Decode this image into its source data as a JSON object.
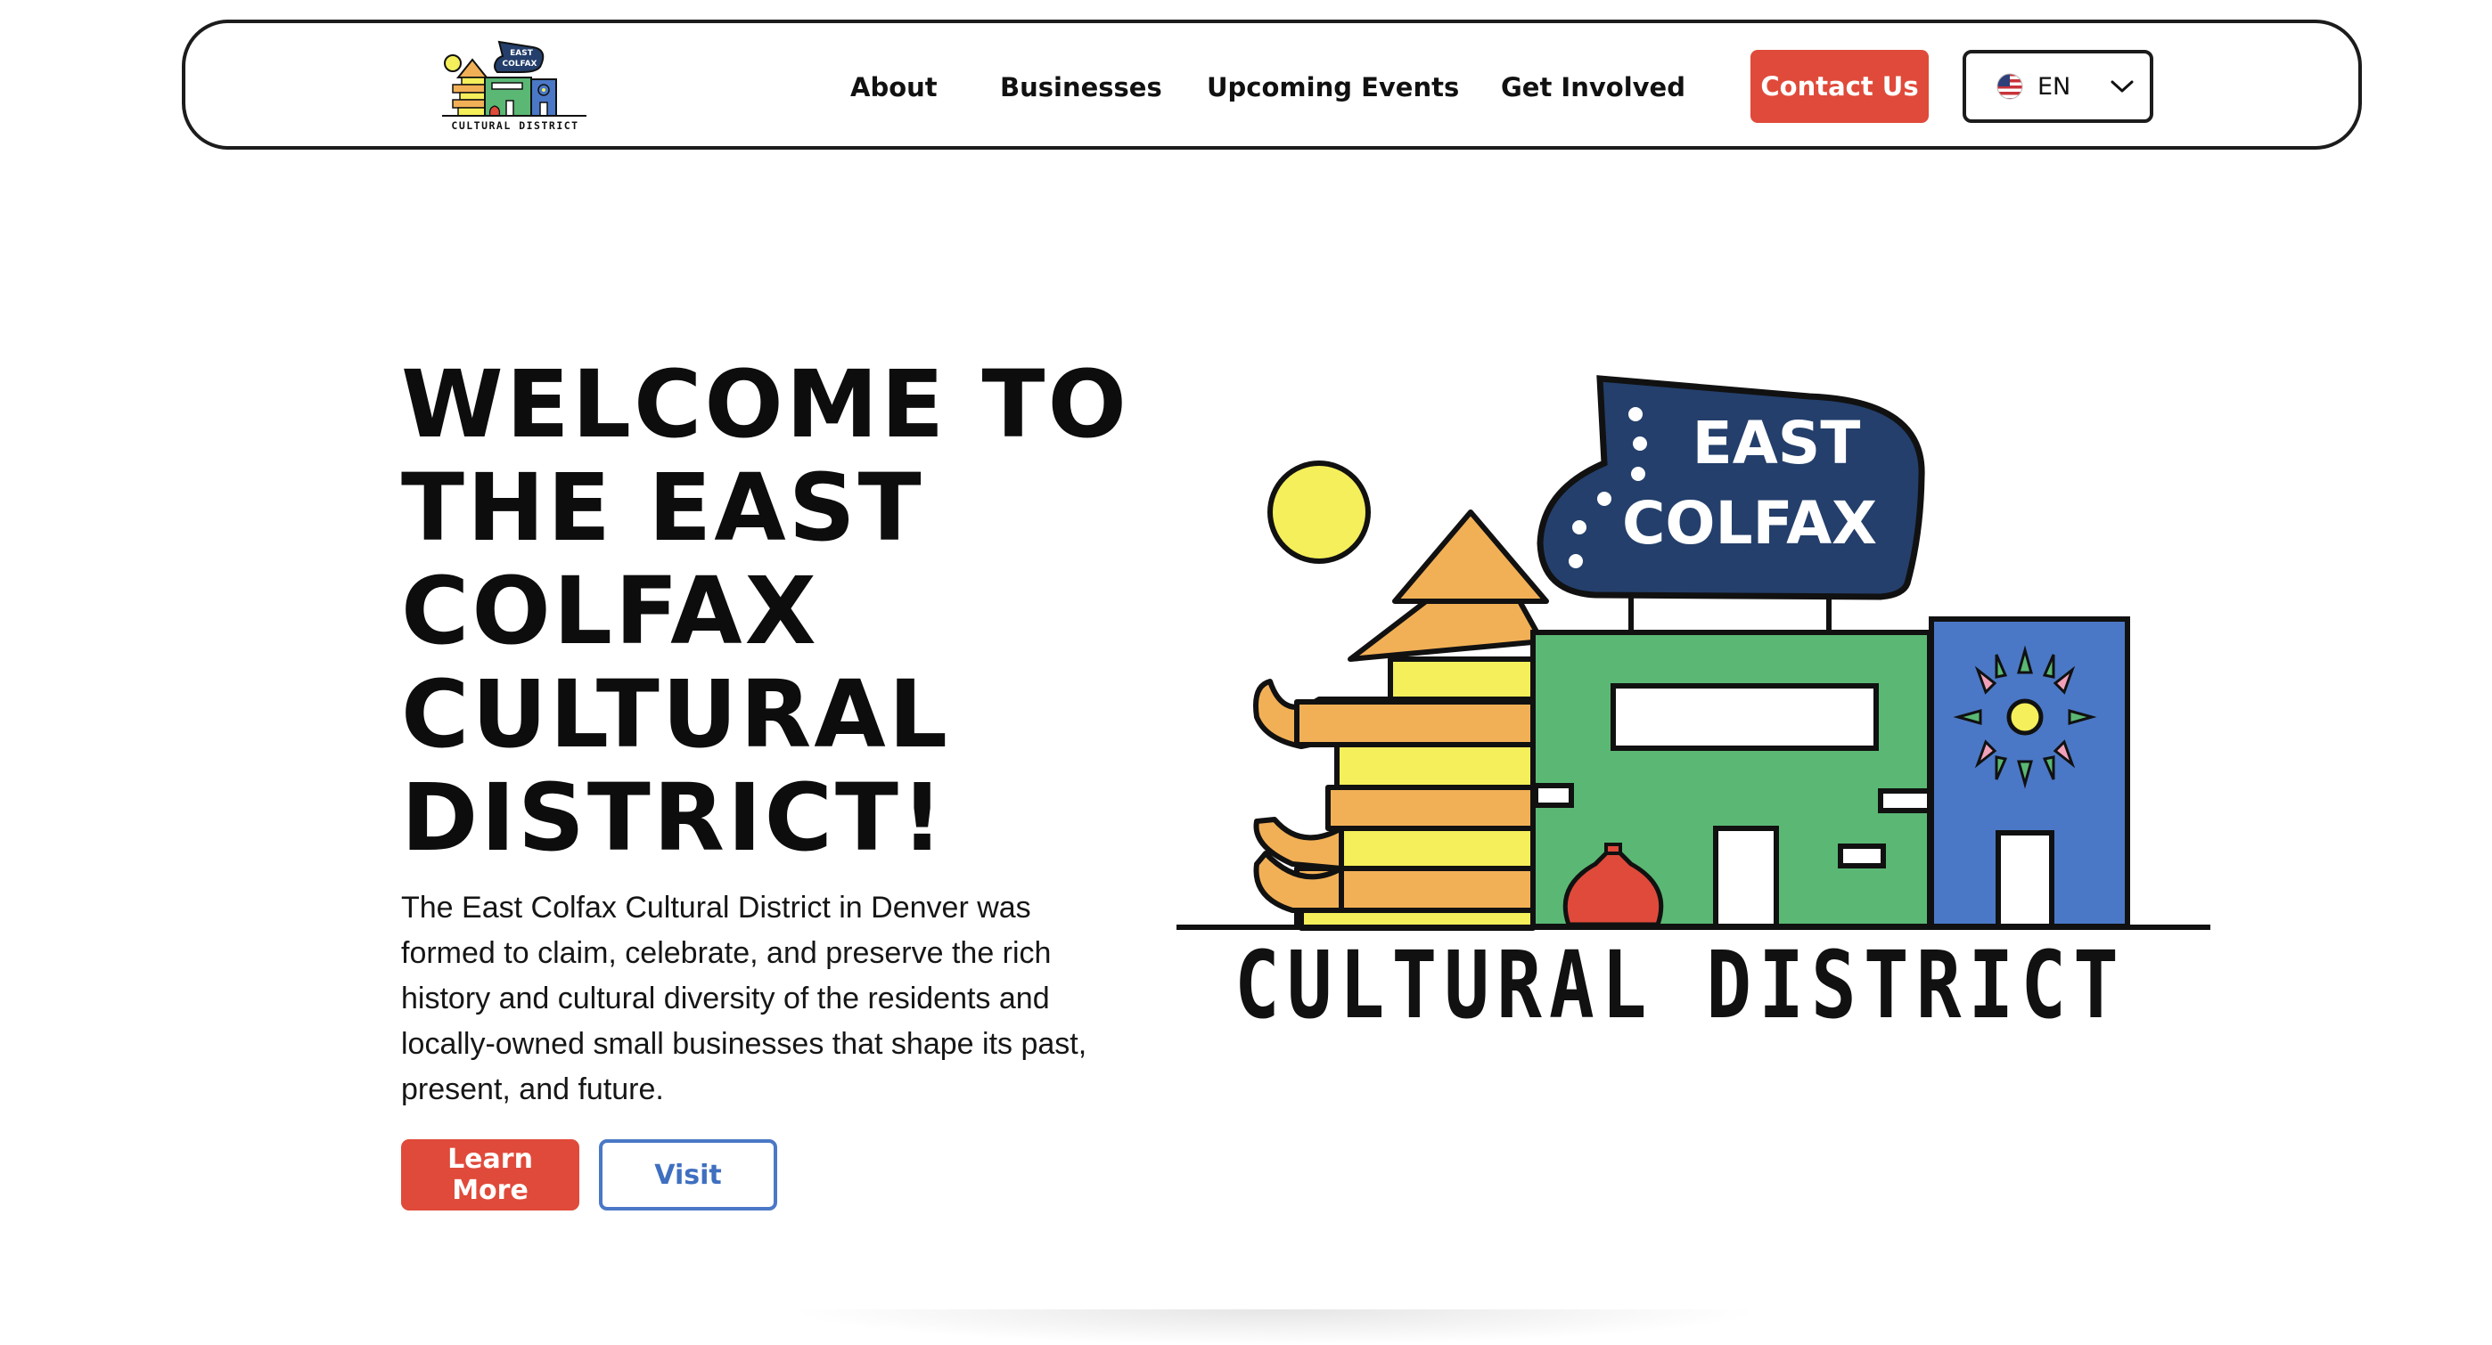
{
  "nav": {
    "logo": {
      "sign_line1": "EAST",
      "sign_line2": "COLFAX",
      "caption": "CULTURAL DISTRICT"
    },
    "links": [
      "About",
      "Businesses",
      "Upcoming Events",
      "Get Involved"
    ],
    "contact_label": "Contact Us",
    "language": {
      "selected": "EN",
      "flag_icon": "us-flag-icon",
      "chevron_icon": "chevron-down-icon"
    }
  },
  "hero": {
    "title": "WELCOME TO THE EAST COLFAX CULTURAL DISTRICT!",
    "description": "The East Colfax Cultural District in Denver was formed to claim, celebrate, and preserve the rich history and cultural diversity of the residents and locally-owned small businesses that shape its past, present, and future.",
    "learn_more_label": "Learn More",
    "visit_label": "Visit",
    "art": {
      "sign_line1": "EAST",
      "sign_line2": "COLFAX",
      "caption": "CULTURAL DISTRICT"
    }
  },
  "colors": {
    "accent_red": "#e04a3a",
    "accent_blue": "#4a78c6",
    "navy": "#243f6b",
    "green": "#5ab874",
    "orange": "#f2b056",
    "yellow": "#f4ef5a"
  }
}
